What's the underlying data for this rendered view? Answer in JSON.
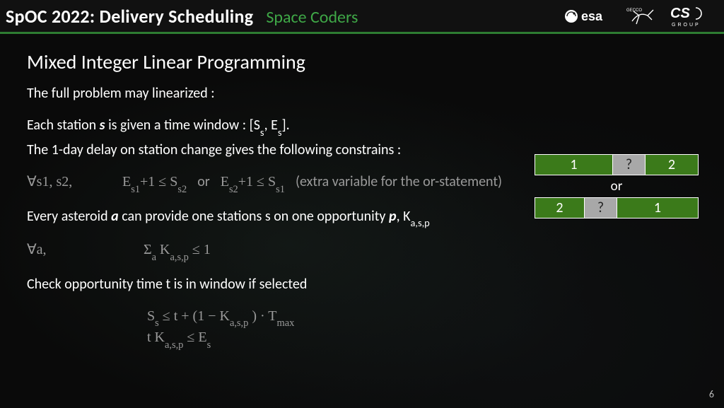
{
  "header": {
    "title": "SpOC 2022: Delivery Scheduling",
    "team": "Space Coders",
    "logos": {
      "esa": "esa",
      "gecco": "GECCO",
      "cs": "CS GROUP"
    }
  },
  "section_title": "Mixed Integer Linear Programming",
  "p1": "The full problem may linearized :",
  "p2a": "Each station ",
  "p2b": " is given a time window : [S",
  "p2c": ", E",
  "p2d": "].",
  "p2_s": "s",
  "p3": "The 1-day delay on station change gives the following constrains :",
  "c1_lead": "∀s1, s2,",
  "c1_math": "E",
  "c1_sub1": "s1",
  "c1_mid1": "+1 ≤ S",
  "c1_sub2": "s2",
  "c1_or": "or",
  "c1_math2": "E",
  "c1_sub3": "s2",
  "c1_mid2": "+1 ≤ S",
  "c1_sub4": "s1",
  "c1_note": "(extra variable for the or-statement)",
  "p4a": "Every asteroid ",
  "p4b": " can provide one stations s on one opportunity ",
  "p4c": ", K",
  "p4_a": "a",
  "p4_p": "p",
  "p4_sub": "a,s,p",
  "c2_lead": "∀a,",
  "c2_sigma": "Σ",
  "c2_sigsub": "a",
  "c2_k": " K",
  "c2_sub": "a,s,p",
  "c2_tail": " ≤  1",
  "p5": "Check opportunity time t is in window if selected",
  "eq1a": "S",
  "eq1a_sub": "s",
  "eq1b": " ≤ t + (1 − K",
  "eq1b_sub": "a,s,p",
  "eq1c": " ) · T",
  "eq1c_sub": "max",
  "eq2a": "t K",
  "eq2a_sub": "a,s,p",
  "eq2b": " ≤ E",
  "eq2b_sub": "s",
  "diagram": {
    "row1": [
      "1",
      "?",
      "2"
    ],
    "or": "or",
    "row2": [
      "2",
      "?",
      "1"
    ]
  },
  "page_num": "6"
}
